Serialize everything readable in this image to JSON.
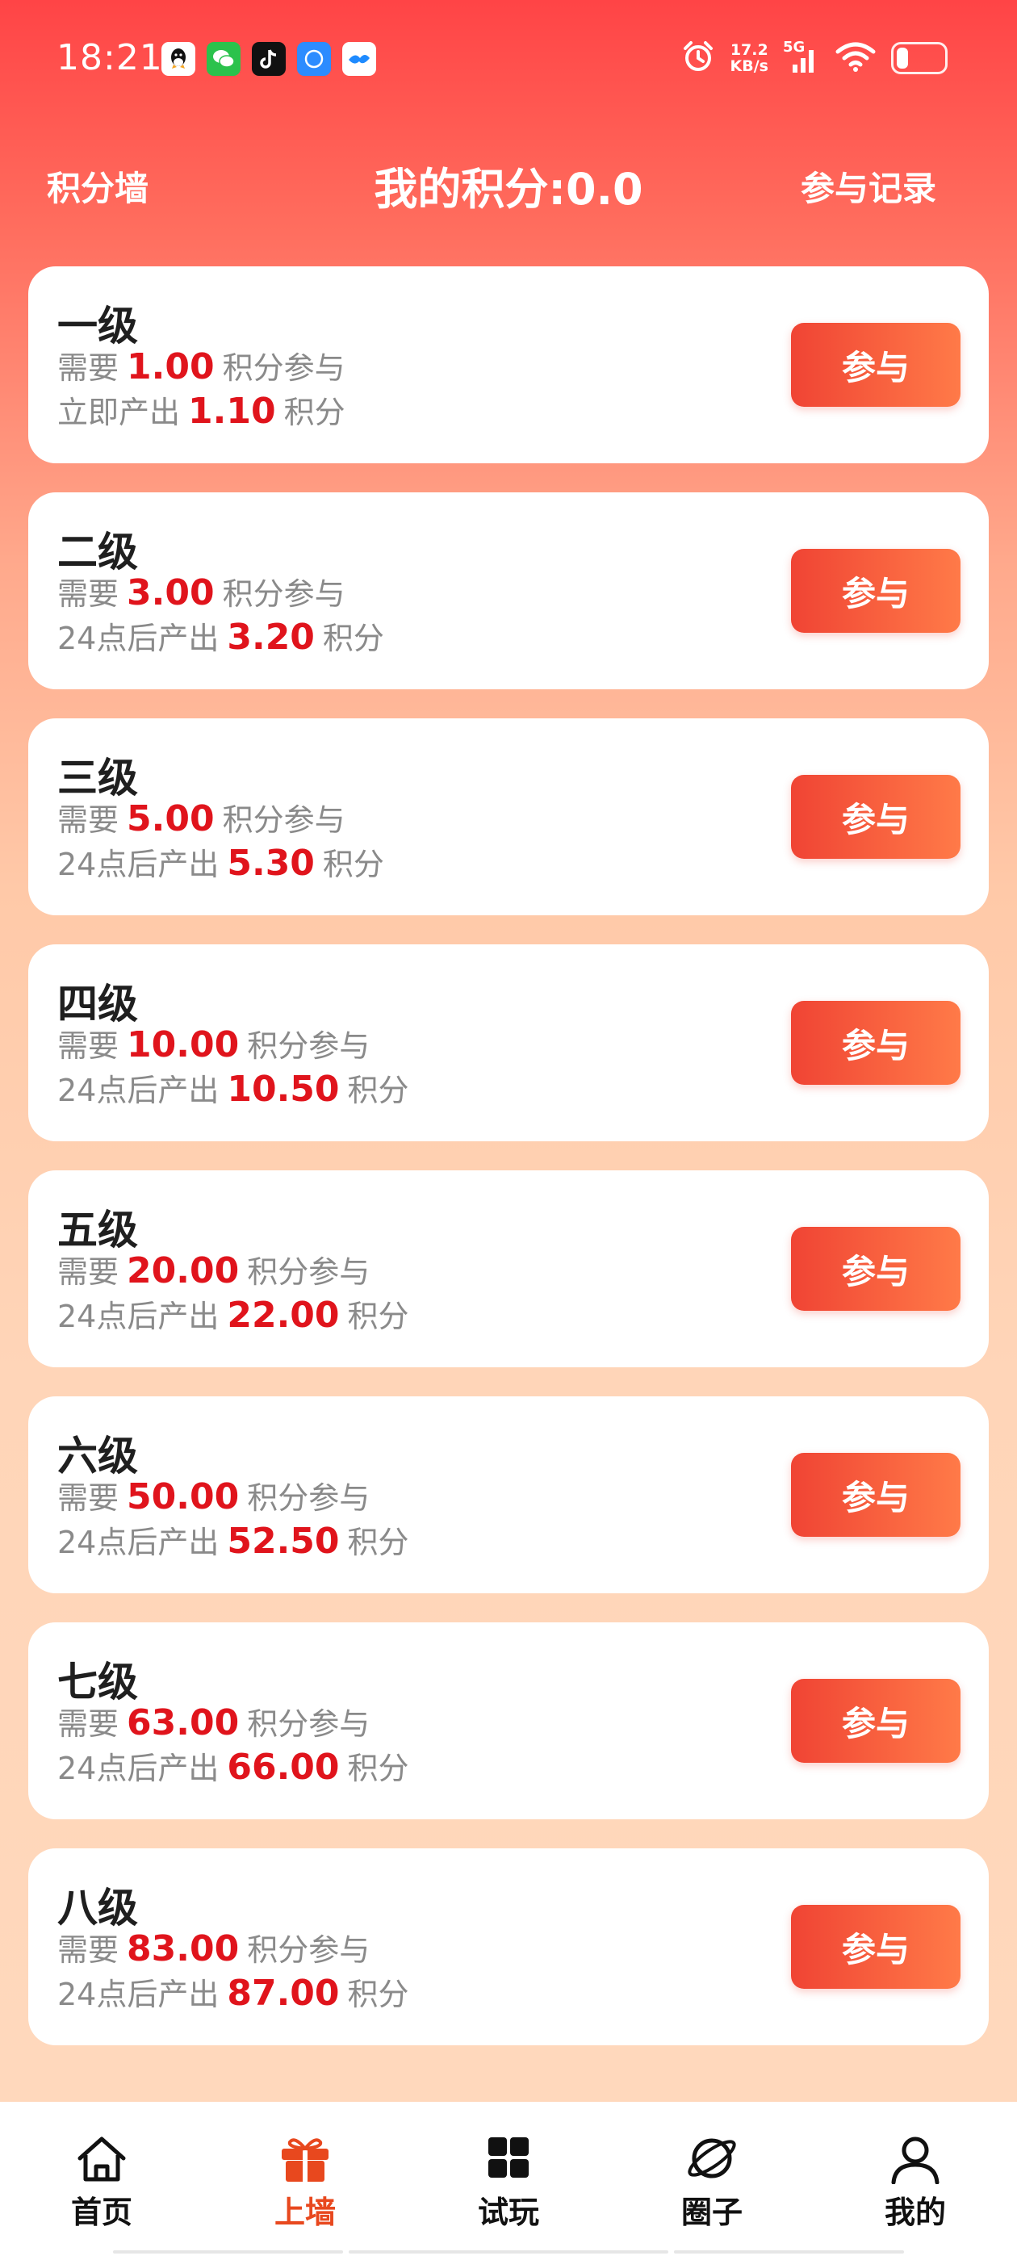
{
  "status_bar": {
    "time": "18:21",
    "net_speed_value": "17.2",
    "net_speed_unit": "KB/s",
    "net_type": "5G",
    "battery_level": 0.2
  },
  "header": {
    "left": "积分墙",
    "title": "我的积分:0.0",
    "right": "参与记录"
  },
  "levels": [
    {
      "name": "一级",
      "need_prefix": "需要",
      "need": "1.00",
      "need_suffix": "积分参与",
      "out_prefix": "立即产出",
      "out": "1.10",
      "out_suffix": "积分",
      "button": "参与"
    },
    {
      "name": "二级",
      "need_prefix": "需要",
      "need": "3.00",
      "need_suffix": "积分参与",
      "out_prefix": "24点后产出",
      "out": "3.20",
      "out_suffix": "积分",
      "button": "参与"
    },
    {
      "name": "三级",
      "need_prefix": "需要",
      "need": "5.00",
      "need_suffix": "积分参与",
      "out_prefix": "24点后产出",
      "out": "5.30",
      "out_suffix": "积分",
      "button": "参与"
    },
    {
      "name": "四级",
      "need_prefix": "需要",
      "need": "10.00",
      "need_suffix": "积分参与",
      "out_prefix": "24点后产出",
      "out": "10.50",
      "out_suffix": "积分",
      "button": "参与"
    },
    {
      "name": "五级",
      "need_prefix": "需要",
      "need": "20.00",
      "need_suffix": "积分参与",
      "out_prefix": "24点后产出",
      "out": "22.00",
      "out_suffix": "积分",
      "button": "参与"
    },
    {
      "name": "六级",
      "need_prefix": "需要",
      "need": "50.00",
      "need_suffix": "积分参与",
      "out_prefix": "24点后产出",
      "out": "52.50",
      "out_suffix": "积分",
      "button": "参与"
    },
    {
      "name": "七级",
      "need_prefix": "需要",
      "need": "63.00",
      "need_suffix": "积分参与",
      "out_prefix": "24点后产出",
      "out": "66.00",
      "out_suffix": "积分",
      "button": "参与"
    },
    {
      "name": "八级",
      "need_prefix": "需要",
      "need": "83.00",
      "need_suffix": "积分参与",
      "out_prefix": "24点后产出",
      "out": "87.00",
      "out_suffix": "积分",
      "button": "参与"
    }
  ],
  "nav": {
    "items": [
      {
        "label": "首页",
        "icon": "home-icon"
      },
      {
        "label": "上墙",
        "icon": "gift-icon"
      },
      {
        "label": "试玩",
        "icon": "grid-icon"
      },
      {
        "label": "圈子",
        "icon": "planet-icon"
      },
      {
        "label": "我的",
        "icon": "user-icon"
      }
    ],
    "active_index": 1
  },
  "colors": {
    "accent": "#e0141c",
    "active_nav": "#e8481e",
    "button_start": "#f04434",
    "button_end": "#ff7a48"
  }
}
